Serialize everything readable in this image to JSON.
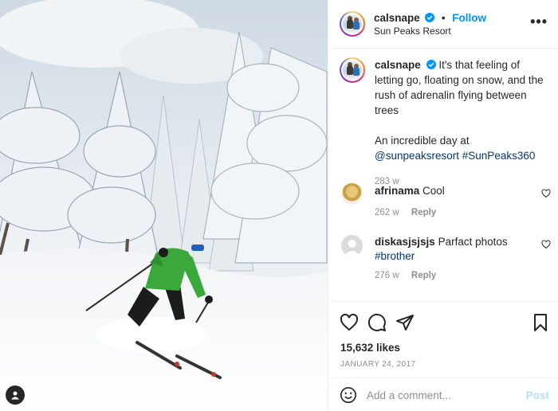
{
  "post": {
    "username": "calsnape",
    "follow_label": "Follow",
    "location": "Sun Peaks Resort",
    "more_label": "•••"
  },
  "caption": {
    "username": "calsnape",
    "text_line1": "It's that feeling of letting go, floating on snow, and the rush of adrenalin flying between trees",
    "text_line2": "An incredible day at",
    "mention": "@sunpeaksresort",
    "hashtag": "#SunPeaks360",
    "time": "283 w"
  },
  "comments": [
    {
      "username": "afrinama",
      "text": "Cool",
      "time": "262 w",
      "reply": "Reply"
    },
    {
      "username": "diskasjsjsjs",
      "text": "Parfact photos",
      "hashtag": "#brother",
      "time": "276 w",
      "reply": "Reply"
    }
  ],
  "stats": {
    "likes": "15,632 likes",
    "date": "JANUARY 24, 2017"
  },
  "composer": {
    "placeholder": "Add a comment...",
    "post_label": "Post"
  },
  "colors": {
    "accent": "#0095f6",
    "link": "#00376b",
    "muted": "#8e8e8e",
    "post_disabled": "#b2dffc",
    "jacket": "#3aa83a"
  },
  "icons": [
    "verified-badge-icon",
    "more-options-icon",
    "heart-icon",
    "comment-icon",
    "share-icon",
    "bookmark-icon",
    "emoji-icon",
    "tag-user-icon"
  ]
}
